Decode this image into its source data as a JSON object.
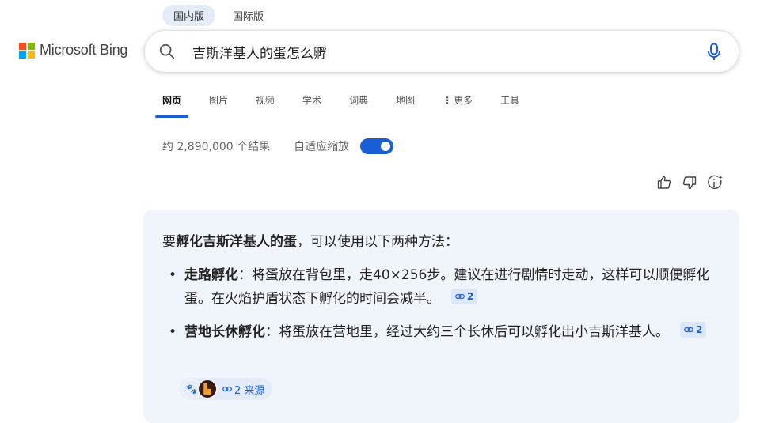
{
  "region_tabs": [
    "国内版",
    "国际版"
  ],
  "logo": {
    "text": "Microsoft Bing",
    "colors": [
      "#f25022",
      "#7fba00",
      "#00a4ef",
      "#ffb900"
    ]
  },
  "search": {
    "query": "吉斯洋基人的蛋怎么孵"
  },
  "nav": {
    "items": [
      "网页",
      "图片",
      "视频",
      "学术",
      "词典",
      "地图",
      "更多",
      "工具"
    ]
  },
  "results": {
    "count_text": "约 2,890,000 个结果",
    "toggle_label": "自适应缩放",
    "toggle_on": true
  },
  "answer": {
    "intro_prefix": "要",
    "intro_bold": "孵化吉斯洋基人的蛋",
    "intro_suffix": "，可以使用以下两种方法：",
    "bullets": [
      {
        "title": "走路孵化",
        "text": "：将蛋放在背包里，走40×256步。建议在进行剧情时走动，这样可以顺便孵化蛋。在火焰护盾状态下孵化的时间会减半。",
        "cite": "2"
      },
      {
        "title": "营地长休孵化",
        "text": "：将蛋放在营地里，经过大约三个长休后可以孵化出小吉斯洋基人。",
        "cite": "2"
      }
    ],
    "sources_label": "2 来源"
  },
  "colors": {
    "accent": "#1a5ed6",
    "card_bg": "#f0f5fc"
  }
}
